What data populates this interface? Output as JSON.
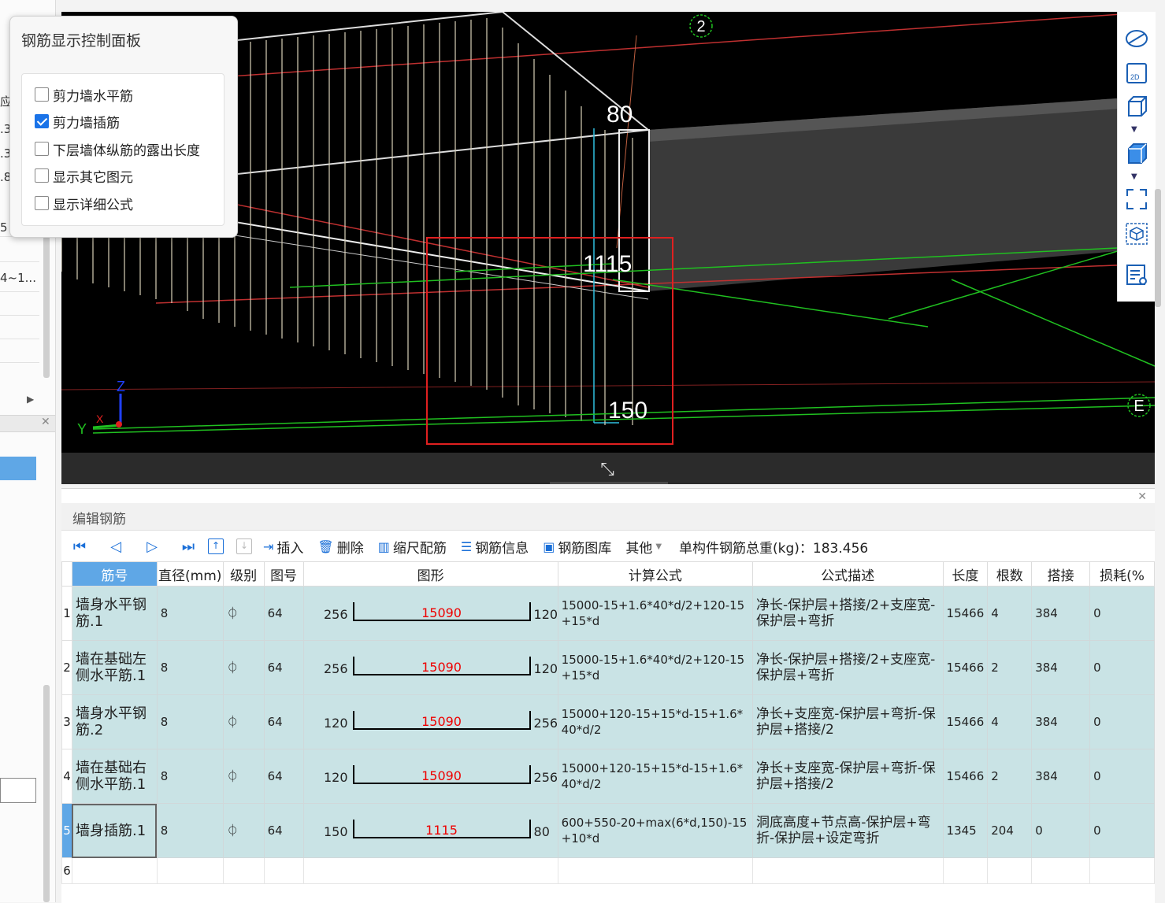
{
  "left_strip": {
    "fragments": [
      "应",
      ".3",
      ".3",
      ".8",
      "5",
      "4~1..."
    ]
  },
  "viewport": {
    "labels": {
      "axis_marker_top": "2",
      "axis_marker_right": "E",
      "dim_top": "80",
      "dim_mid": "1115",
      "dim_bottom": "150",
      "axis_z": "Z",
      "axis_y": "Y",
      "axis_x": "X"
    }
  },
  "control_panel": {
    "title": "钢筋显示控制面板",
    "options": [
      {
        "label": "剪力墙水平筋",
        "checked": false
      },
      {
        "label": "剪力墙插筋",
        "checked": true
      },
      {
        "label": "下层墙体纵筋的露出长度",
        "checked": false
      },
      {
        "label": "显示其它图元",
        "checked": false
      },
      {
        "label": "显示详细公式",
        "checked": false
      }
    ]
  },
  "editor": {
    "title": "编辑钢筋",
    "toolbar": {
      "insert": "插入",
      "delete": "删除",
      "scale_rebar": "缩尺配筋",
      "rebar_info": "钢筋信息",
      "rebar_library": "钢筋图库",
      "other": "其他",
      "total_label": "单构件钢筋总重(kg)：183.456"
    },
    "columns": [
      "筋号",
      "直径(mm)",
      "级别",
      "图号",
      "图形",
      "计算公式",
      "公式描述",
      "长度",
      "根数",
      "搭接",
      "损耗(%"
    ],
    "rows": [
      {
        "idx": "1",
        "name": "墙身水平钢筋.1",
        "diameter": "8",
        "grade": "⏀",
        "fig": "64",
        "shape_left": "256",
        "shape_mid": "15090",
        "shape_right": "120",
        "formula": "15000-15+1.6*40*d/2+120-15+15*d",
        "desc": "净长-保护层+搭接/2+支座宽-保护层+弯折",
        "length": "15466",
        "count": "4",
        "lap": "384",
        "loss": "0"
      },
      {
        "idx": "2",
        "name": "墙在基础左侧水平筋.1",
        "diameter": "8",
        "grade": "⏀",
        "fig": "64",
        "shape_left": "256",
        "shape_mid": "15090",
        "shape_right": "120",
        "formula": "15000-15+1.6*40*d/2+120-15+15*d",
        "desc": "净长-保护层+搭接/2+支座宽-保护层+弯折",
        "length": "15466",
        "count": "2",
        "lap": "384",
        "loss": "0"
      },
      {
        "idx": "3",
        "name": "墙身水平钢筋.2",
        "diameter": "8",
        "grade": "⏀",
        "fig": "64",
        "shape_left": "120",
        "shape_mid": "15090",
        "shape_right": "256",
        "formula": "15000+120-15+15*d-15+1.6*40*d/2",
        "desc": "净长+支座宽-保护层+弯折-保护层+搭接/2",
        "length": "15466",
        "count": "4",
        "lap": "384",
        "loss": "0"
      },
      {
        "idx": "4",
        "name": "墙在基础右侧水平筋.1",
        "diameter": "8",
        "grade": "⏀",
        "fig": "64",
        "shape_left": "120",
        "shape_mid": "15090",
        "shape_right": "256",
        "formula": "15000+120-15+15*d-15+1.6*40*d/2",
        "desc": "净长+支座宽-保护层+弯折-保护层+搭接/2",
        "length": "15466",
        "count": "2",
        "lap": "384",
        "loss": "0"
      },
      {
        "idx": "5",
        "name": "墙身插筋.1",
        "diameter": "8",
        "grade": "⏀",
        "fig": "64",
        "shape_left": "150",
        "shape_mid": "1115",
        "shape_right": "80",
        "formula": "600+550-20+max(6*d,150)-15+10*d",
        "desc": "洞底高度+节点高-保护层+弯折-保护层+设定弯折",
        "length": "1345",
        "count": "204",
        "lap": "0",
        "loss": "0"
      }
    ],
    "empty_row_idx": "6"
  }
}
